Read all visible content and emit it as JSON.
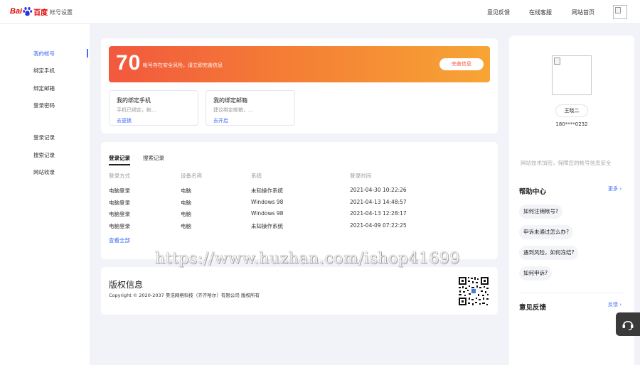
{
  "header": {
    "logo_bai": "Bai",
    "logo_du": "百度",
    "subtitle": "帐号设置",
    "nav": [
      "意见反馈",
      "在线客服",
      "网站首页"
    ]
  },
  "sidebar": {
    "items": [
      {
        "label": "我的帐号",
        "active": true
      },
      {
        "label": "绑定手机"
      },
      {
        "label": "绑定邮箱"
      },
      {
        "label": "登录密码"
      },
      {
        "label": "登录记录"
      },
      {
        "label": "搜索记录"
      },
      {
        "label": "网站收录"
      }
    ]
  },
  "security": {
    "score": "70",
    "message": "帐号存在安全风险，请立即完善信息",
    "button": "完善信息"
  },
  "bindings": [
    {
      "title": "我的绑定手机",
      "desc": "手机已绑定，帐...",
      "link": "去更换"
    },
    {
      "title": "我的绑定邮箱",
      "desc": "建议绑定邮箱，...",
      "link": "去开启"
    }
  ],
  "records": {
    "tabs": [
      "登录记录",
      "搜索记录"
    ],
    "headers": [
      "登录方式",
      "设备名称",
      "系统",
      "登录时间"
    ],
    "rows": [
      [
        "电脑登录",
        "电脑",
        "未知操作系统",
        "2021-04-30 10:22:26"
      ],
      [
        "电脑登录",
        "电脑",
        "Windows 98",
        "2021-04-13 14:48:57"
      ],
      [
        "电脑登录",
        "电脑",
        "Windows 98",
        "2021-04-13 12:28:17"
      ],
      [
        "电脑登录",
        "电脑",
        "未知操作系统",
        "2021-04-09 07:22:25"
      ]
    ],
    "more": "查看全部"
  },
  "copyright": {
    "title": "版权信息",
    "text": "Copyright © 2020-2037 昊浩网络科技（齐齐哈尔）有限公司 版权所有"
  },
  "profile": {
    "name": "王晓二",
    "phone": "180****0232",
    "security_note": "网站技术加密，保障您的帐号信息安全"
  },
  "help": {
    "title": "帮助中心",
    "more": "更多",
    "questions": [
      "如何注销帐号?",
      "申诉未通过怎么办?",
      "遇到风险，如何冻结?",
      "如何申诉?"
    ]
  },
  "feedback": {
    "title": "意见反馈",
    "link": "反馈"
  },
  "watermark": "https://www.huzhan.com/ishop41699",
  "colors": {
    "accent": "#3d6ef5",
    "banner_start": "#f2583e",
    "banner_end": "#f7a535"
  }
}
